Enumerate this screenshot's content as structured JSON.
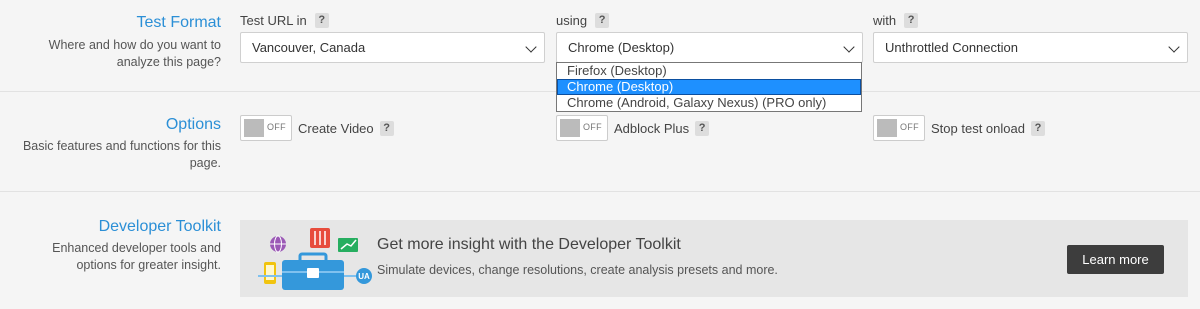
{
  "test_format": {
    "title": "Test Format",
    "description": "Where and how do you want to analyze this page?",
    "location": {
      "label": "Test URL in",
      "help": "?",
      "value": "Vancouver, Canada"
    },
    "browser": {
      "label": "using",
      "help": "?",
      "value": "Chrome (Desktop)",
      "options": [
        "Firefox (Desktop)",
        "Chrome (Desktop)",
        "Chrome (Android, Galaxy Nexus) (PRO only)"
      ],
      "highlighted_index": 1
    },
    "connection": {
      "label": "with",
      "help": "?",
      "value": "Unthrottled Connection"
    }
  },
  "options": {
    "title": "Options",
    "description": "Basic features and functions for this page.",
    "toggles": [
      {
        "state": "OFF",
        "label": "Create Video",
        "help": "?"
      },
      {
        "state": "OFF",
        "label": "Adblock Plus",
        "help": "?"
      },
      {
        "state": "OFF",
        "label": "Stop test onload",
        "help": "?"
      }
    ]
  },
  "developer_toolkit": {
    "title": "Developer Toolkit",
    "description": "Enhanced developer tools and options for greater insight.",
    "promo_title": "Get more insight with the Developer Toolkit",
    "promo_subtitle": "Simulate devices, change resolutions, create analysis presets and more.",
    "button_label": "Learn more",
    "badge_text": "UA"
  }
}
